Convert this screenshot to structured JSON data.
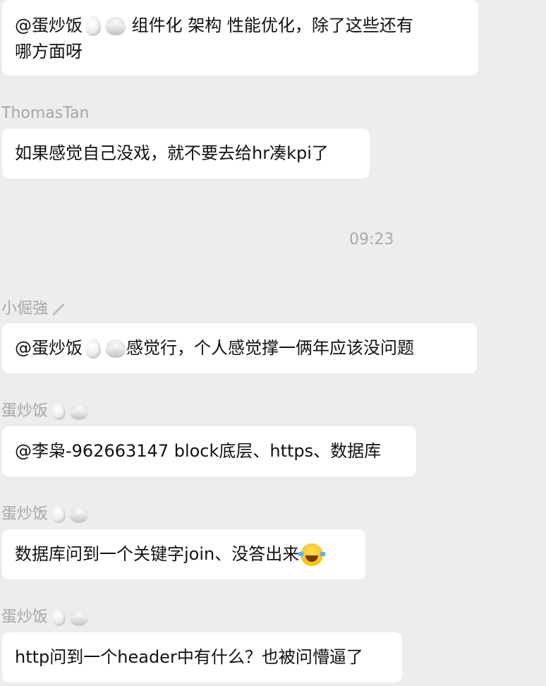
{
  "messages": [
    {
      "id": "m1",
      "mention": "@蛋炒饭",
      "text_line1": " 组件化  架构  性能优化，除了这些还有",
      "text_line2": "哪方面呀"
    },
    {
      "id": "m2",
      "sender": "ThomasTan",
      "text": "如果感觉自己没戏，就不要去给hr凑kpi了"
    },
    {
      "id": "m3",
      "sender": "小倔強",
      "mention": "@蛋炒饭",
      "text": " 感觉行，个人感觉撑一俩年应该没问题"
    },
    {
      "id": "m4",
      "sender": "蛋炒饭",
      "text": "@李枭-962663147 block底层、https、数据库"
    },
    {
      "id": "m5",
      "sender": "蛋炒饭",
      "text": "数据库问到一个关键字join、没答出来"
    },
    {
      "id": "m6",
      "sender": "蛋炒饭",
      "text": "http问到一个header中有什么？也被问懵逼了"
    }
  ],
  "timestamp": "09:23",
  "icons": {
    "egg": "egg-emoji-icon",
    "bowl": "rice-bowl-emoji-icon",
    "pen": "pen-icon",
    "laugh": "tears-of-joy-emoji-icon"
  },
  "colors": {
    "background": "#ededed",
    "bubble": "#ffffff",
    "sender_text": "#a6a6a6",
    "message_text": "#111111"
  }
}
